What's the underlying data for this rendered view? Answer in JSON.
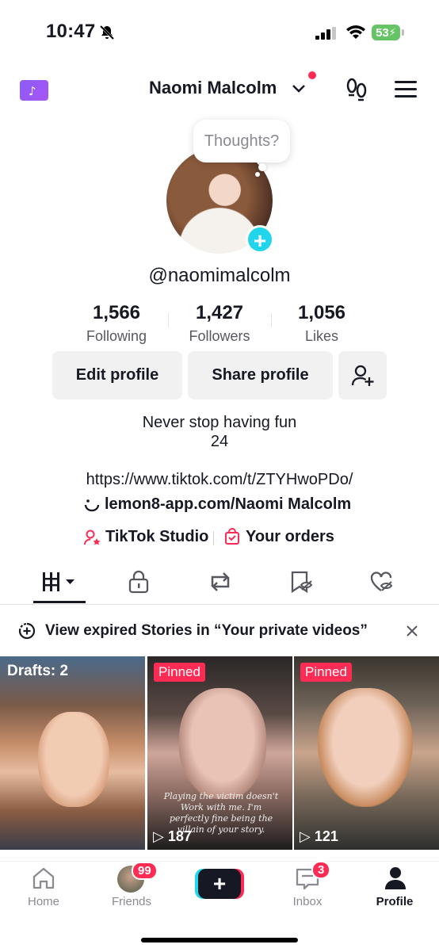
{
  "status_bar": {
    "time": "10:47",
    "battery": "53"
  },
  "header": {
    "title": "Naomi Malcolm"
  },
  "profile": {
    "bubble": "Thoughts?",
    "handle": "@naomimalcolm",
    "stats": [
      {
        "value": "1,566",
        "label": "Following"
      },
      {
        "value": "1,427",
        "label": "Followers"
      },
      {
        "value": "1,056",
        "label": "Likes"
      }
    ],
    "edit_label": "Edit profile",
    "share_label": "Share profile",
    "bio_line1": "Never stop having fun",
    "bio_line2": "24",
    "link1": "https://www.tiktok.com/t/ZTYHwoPDo/",
    "link2": "lemon8-app.com/Naomi Malcolm",
    "studio": "TikTok Studio",
    "orders": "Your orders"
  },
  "banner": {
    "text": "View expired Stories in “Your private videos”"
  },
  "videos": [
    {
      "badge": "Drafts: 2"
    },
    {
      "badge": "Pinned",
      "caption": "Playing the victim doesn't Work with me. I'm perfectly fine being the villain of your story.",
      "views": "187"
    },
    {
      "badge": "Pinned",
      "views": "121"
    }
  ],
  "tabbar": {
    "home": "Home",
    "friends": "Friends",
    "friends_badge": "99",
    "inbox": "Inbox",
    "inbox_badge": "3",
    "profile": "Profile"
  },
  "colors": {
    "accent": "#fe2c55",
    "cyan": "#20d5ec",
    "text": "#161823"
  }
}
